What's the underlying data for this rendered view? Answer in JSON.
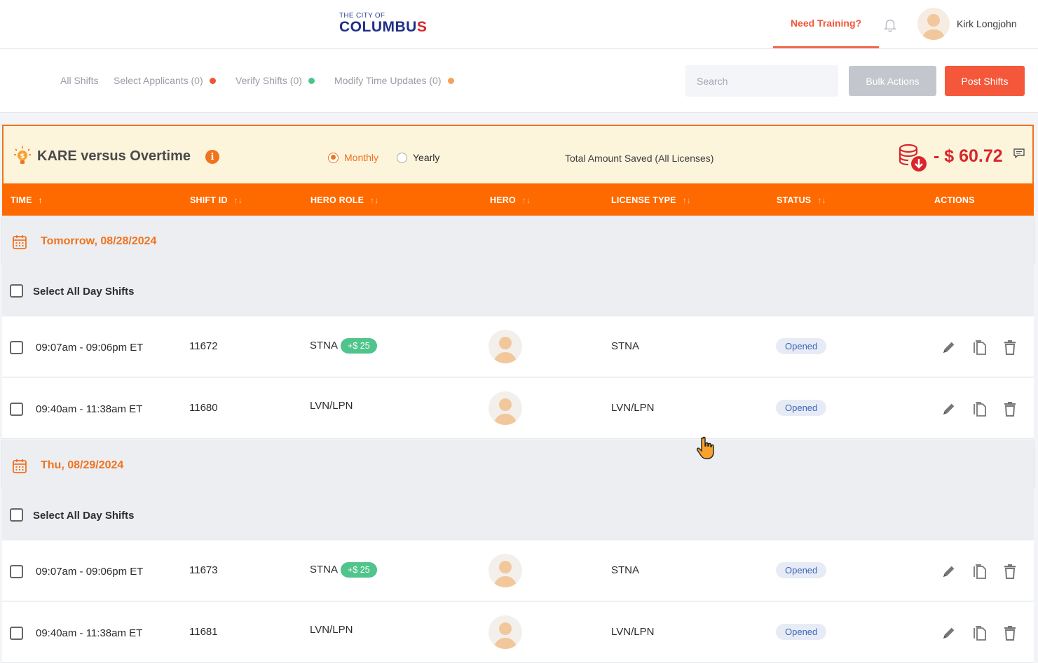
{
  "header": {
    "logo_small": "THE CITY OF",
    "logo_big_a": "COLUMB",
    "logo_big_b": "U",
    "logo_big_c": "S",
    "training_label": "Need Training?",
    "user_name": "Kirk Longjohn"
  },
  "tabs": [
    {
      "label": "All Shifts"
    },
    {
      "label": "Select Applicants (0)",
      "dot_color": "#f0553a"
    },
    {
      "label": "Verify Shifts (0)",
      "dot_color": "#4cc48b"
    },
    {
      "label": "Modify Time Updates (0)",
      "dot_color": "#f5a15a"
    }
  ],
  "search": {
    "placeholder": "Search"
  },
  "buttons": {
    "bulk_actions": "Bulk Actions",
    "post_shifts": "Post Shifts"
  },
  "kare": {
    "title": "KARE versus Overtime",
    "info": "i",
    "monthly": "Monthly",
    "yearly": "Yearly",
    "selected_period": "Monthly",
    "saved_label": "Total Amount Saved (All Licenses)",
    "amount": "- $ 60.72"
  },
  "columns": [
    "TIME",
    "SHIFT ID",
    "HERO ROLE",
    "HERO",
    "LICENSE TYPE",
    "STATUS",
    "ACTIONS"
  ],
  "sort_glyphs": {
    "up": "↑",
    "down": "↓"
  },
  "select_all_label": "Select All Day Shifts",
  "groups": [
    {
      "date": "Tomorrow, 08/28/2024",
      "rows": [
        {
          "time": "09:07am - 09:06pm ET",
          "shift_id": "11672",
          "role": "STNA",
          "bonus": "+$ 25",
          "license": "STNA",
          "status": "Opened"
        },
        {
          "time": "09:40am - 11:38am ET",
          "shift_id": "11680",
          "role": "LVN/LPN",
          "bonus": "",
          "license": "LVN/LPN",
          "status": "Opened"
        }
      ]
    },
    {
      "date": "Thu, 08/29/2024",
      "rows": [
        {
          "time": "09:07am - 09:06pm ET",
          "shift_id": "11673",
          "role": "STNA",
          "bonus": "+$ 25",
          "license": "STNA",
          "status": "Opened"
        },
        {
          "time": "09:40am - 11:38am ET",
          "shift_id": "11681",
          "role": "LVN/LPN",
          "bonus": "",
          "license": "LVN/LPN",
          "status": "Opened"
        }
      ]
    }
  ],
  "icons": {
    "edit": "pencil-icon",
    "copy": "copy-icon",
    "delete": "trash-icon",
    "calendar": "calendar-icon",
    "bell": "bell-icon",
    "bulb": "lightbulb-icon",
    "coins": "coins-download-icon",
    "cursor": "hand-cursor-icon"
  },
  "colors": {
    "accent": "#ff6a00",
    "red": "#d8262c",
    "green": "#4fc48b",
    "banner_bg": "#fdf4dc"
  }
}
